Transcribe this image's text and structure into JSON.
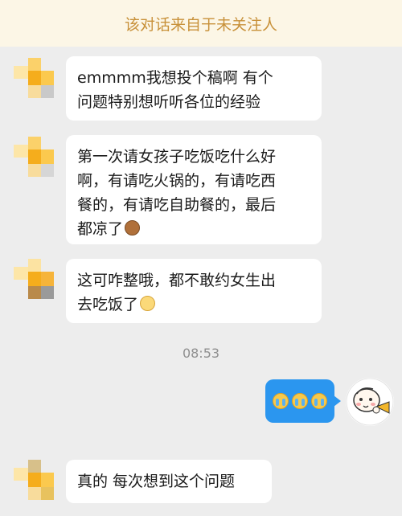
{
  "banner": {
    "text": "该对话来自于未关注人"
  },
  "messages": [
    {
      "lines": [
        "emmmm我想投个稿啊 有个",
        "问题特别想听听各位的经验"
      ]
    },
    {
      "lines": [
        "第一次请女孩子吃饭吃什么好",
        "啊，有请吃火锅的，有请吃西",
        "餐的，有请吃自助餐的，最后",
        "都凉了"
      ],
      "emoji": "monkey-emoji"
    },
    {
      "lines": [
        "这可咋整哦，都不敢约女生出",
        "去吃饭了"
      ],
      "emoji": "sad-face-emoji"
    },
    {
      "lines": [
        "真的 每次想到这个问题"
      ]
    }
  ],
  "timestamp": "08:53",
  "my_message": {
    "emojis": [
      "crying-laughing-emoji",
      "crying-laughing-emoji",
      "crying-laughing-emoji"
    ]
  },
  "colors": {
    "background": "#ededed",
    "banner_bg": "#fcf6e6",
    "banner_text": "#c8913a",
    "sent_bubble": "#2b96ef",
    "received_bubble": "#ffffff"
  }
}
